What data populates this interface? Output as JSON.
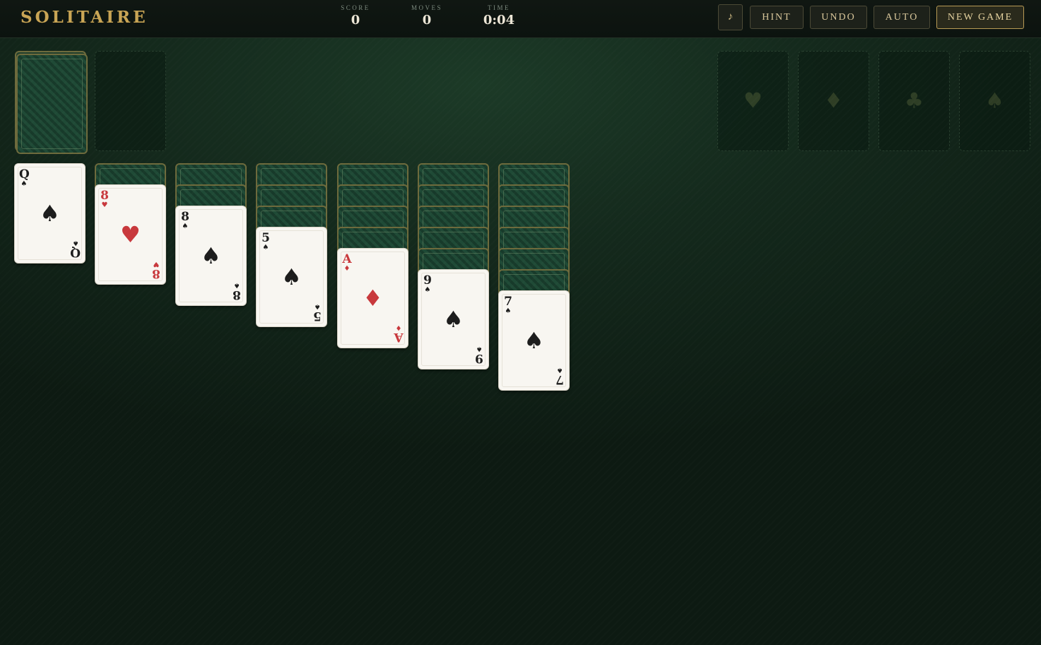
{
  "header": {
    "title": "SOLITAIRE",
    "stats": [
      {
        "label": "SCORE",
        "value": "0"
      },
      {
        "label": "MOVES",
        "value": "0"
      },
      {
        "label": "TIME",
        "value": "0:04"
      }
    ],
    "buttons": {
      "sound": "♪",
      "hint": "HINT",
      "undo": "UNDO",
      "auto": "AUTO",
      "new_game": "NEW GAME"
    }
  },
  "foundations": [
    "♥",
    "♦",
    "♣",
    "♠"
  ],
  "tableau": [
    {
      "face_down": 0,
      "rank": "Q",
      "suit": "♠",
      "color": "black"
    },
    {
      "face_down": 1,
      "rank": "8",
      "suit": "♥",
      "color": "red"
    },
    {
      "face_down": 2,
      "rank": "8",
      "suit": "♠",
      "color": "black"
    },
    {
      "face_down": 3,
      "rank": "5",
      "suit": "♠",
      "color": "black"
    },
    {
      "face_down": 4,
      "rank": "A",
      "suit": "♦",
      "color": "red"
    },
    {
      "face_down": 5,
      "rank": "9",
      "suit": "♠",
      "color": "black"
    },
    {
      "face_down": 6,
      "rank": "7",
      "suit": "♠",
      "color": "black"
    }
  ],
  "colors": {
    "accent_gold": "#c9a555",
    "felt": "#14291c",
    "red_suit": "#c8383c",
    "black_suit": "#1c1c1c"
  }
}
